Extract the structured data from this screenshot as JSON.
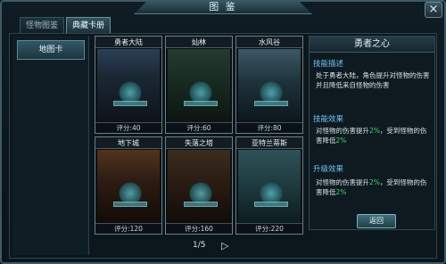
{
  "window": {
    "title": "图 鉴",
    "close_glyph": "×"
  },
  "tabs": [
    {
      "label": "怪物图鉴",
      "active": false
    },
    {
      "label": "典藏卡册",
      "active": true
    }
  ],
  "sidebar": {
    "items": [
      {
        "label": "地图卡"
      }
    ]
  },
  "cards": [
    {
      "name": "勇者大陆",
      "score": "评分:40"
    },
    {
      "name": "灿林",
      "score": "评分:60"
    },
    {
      "name": "水风谷",
      "score": "评分:80"
    },
    {
      "name": "地下城",
      "score": "评分:120"
    },
    {
      "name": "失落之塔",
      "score": "评分:160"
    },
    {
      "name": "亚特兰蒂斯",
      "score": "评分:220"
    }
  ],
  "pager": {
    "page": "1/5",
    "next_glyph": "▷"
  },
  "detail": {
    "title": "勇者之心",
    "skill_desc_head": "技能描述",
    "skill_desc": "处于勇者大陆，角色提升对怪物的伤害并且降低来自怪物的伤害",
    "skill_effect_head": "技能效果",
    "skill_effect_a": "对怪物的伤害提升",
    "skill_effect_pct1": "2%",
    "skill_effect_b": "，受到怪物的伤害降低",
    "skill_effect_pct2": "2%",
    "upgrade_head": "升级效果",
    "upgrade_a": "对怪物的伤害提升",
    "upgrade_pct1": "2%",
    "upgrade_b": "，受到怪物的伤害降低",
    "upgrade_pct2": "2%"
  },
  "buttons": {
    "return_label": "返回"
  },
  "colors": {
    "highlight": "#3cd56a",
    "section_head": "#6fc4f0"
  }
}
